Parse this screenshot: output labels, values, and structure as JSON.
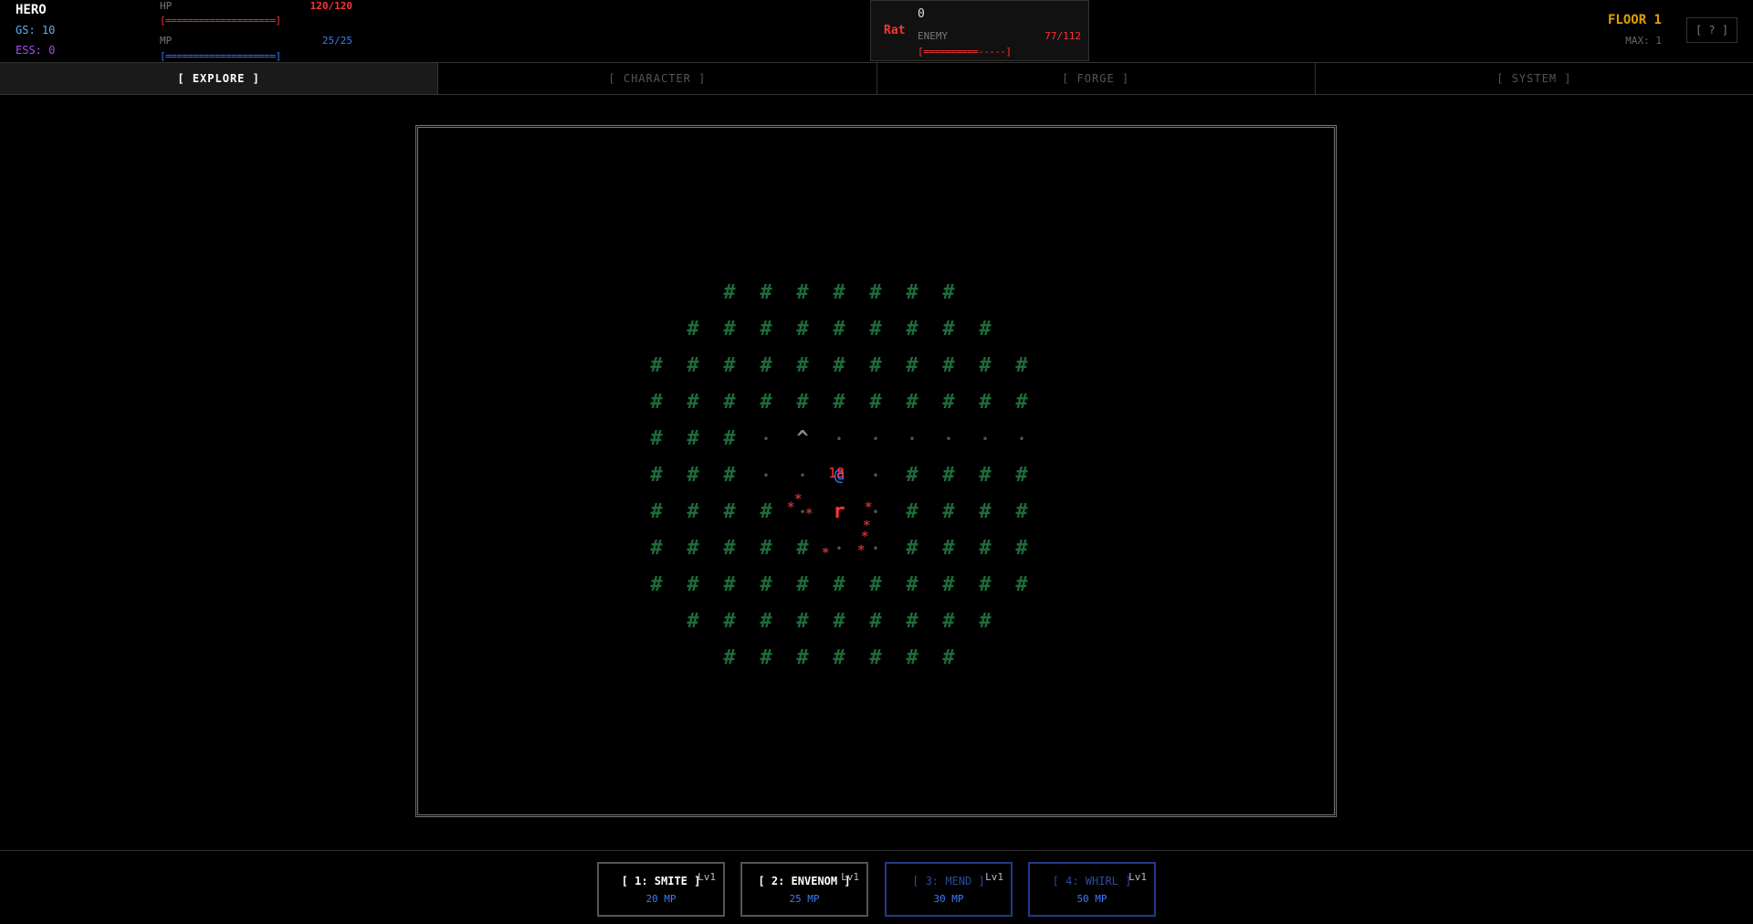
{
  "hero": {
    "name": "HERO",
    "gs": "GS: 10",
    "ess": "ESS: 0",
    "hp_label": "HP",
    "hp_value": "120/120",
    "hp_bar": "[====================]",
    "hp_fraction": 1.0,
    "mp_label": "MP",
    "mp_value": "25/25",
    "mp_bar": "[====================]",
    "mp_fraction": 1.0
  },
  "enemy": {
    "name": "Rat",
    "counter": "0",
    "label": "ENEMY",
    "hp_value": "77/112",
    "hp_bar": "[==========-----]",
    "hp_fraction": 0.69
  },
  "floor": {
    "title": "FLOOR 1",
    "max": "MAX: 1",
    "help": "[ ? ]"
  },
  "tabs": [
    {
      "label": "[ EXPLORE ]",
      "active": true
    },
    {
      "label": "[ CHARACTER ]"
    },
    {
      "label": "[ FORGE ]"
    },
    {
      "label": "[ SYSTEM ]"
    }
  ],
  "map": {
    "rows": [
      "  #######  ",
      " ######### ",
      "###########",
      "###########",
      "###.^......",
      "###..@.####",
      "####.r.####",
      "#####..####",
      "###########",
      " ######### ",
      "  #######  "
    ],
    "damage_number": "18",
    "particle_glyph": "*"
  },
  "skills": [
    {
      "label": "[ 1: SMITE ]",
      "level": "Lv1",
      "cost": "20 MP",
      "available": true
    },
    {
      "label": "[ 2: ENVENOM ]",
      "level": "Lv1",
      "cost": "25 MP",
      "available": true
    },
    {
      "label": "[ 3: MEND ]",
      "level": "Lv1",
      "cost": "30 MP",
      "available": false
    },
    {
      "label": "[ 4: WHIRL ]",
      "level": "Lv1",
      "cost": "50 MP",
      "available": false
    }
  ],
  "colors": {
    "wall": "#1e6b3a",
    "player": "#3a7bff",
    "enemy": "#ff3333",
    "hp": "#ff3333",
    "mp": "#3a7bff",
    "floor_title": "#e0a000"
  }
}
